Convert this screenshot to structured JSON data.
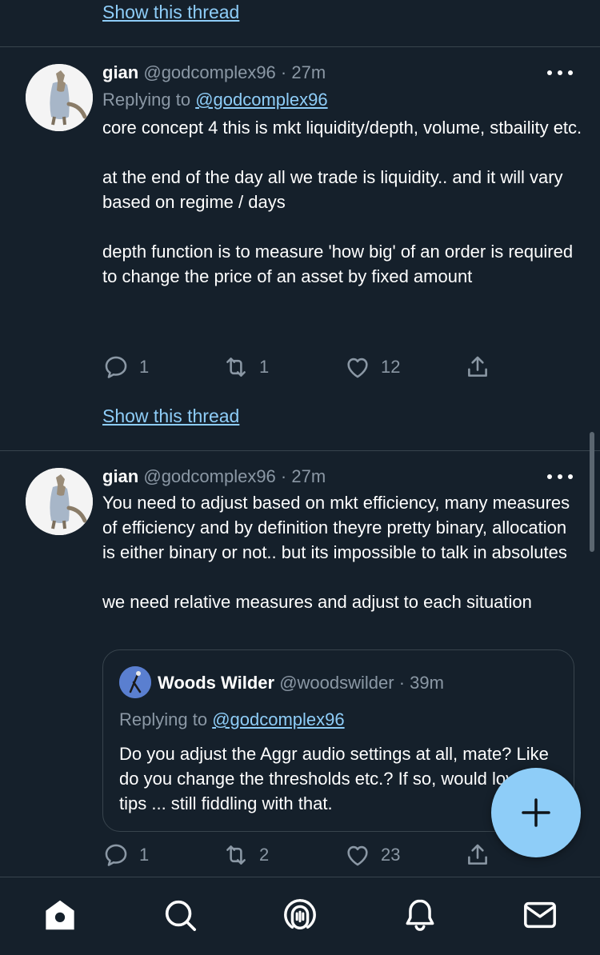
{
  "top": {
    "show_thread": "Show this thread"
  },
  "tweets": [
    {
      "name": "gian",
      "handle": "@godcomplex96",
      "sep": " · ",
      "time": "27m",
      "replying_prefix": "Replying to ",
      "replying_to": "@godcomplex96",
      "paragraphs": [
        "core concept 4 this is mkt liquidity/depth, volume, stbaility etc.",
        "at the end of the day all we trade is liquidity.. and it will vary based on regime / days",
        "depth function is to measure 'how big' of an order is required to change the price of an asset by fixed amount"
      ],
      "replies": "1",
      "retweets": "1",
      "likes": "12",
      "show_thread": "Show this thread"
    },
    {
      "name": "gian",
      "handle": "@godcomplex96",
      "sep": " · ",
      "time": "27m",
      "paragraphs": [
        "You need to adjust based on mkt efficiency, many measures of efficiency and by definition theyre pretty binary, allocation is either binary or not.. but its impossible to talk in absolutes",
        "we need relative measures and adjust to each situation"
      ],
      "quote": {
        "name": "Woods Wilder",
        "handle": "@woodswilder",
        "sep": " · ",
        "time": "39m",
        "replying_prefix": "Replying to ",
        "replying_to": "@godcomplex96",
        "text": "Do you adjust the Aggr audio settings at all, mate? Like do you change the thresholds etc.? If so, would love any tips ... still fiddling with that."
      },
      "replies": "1",
      "retweets": "2",
      "likes": "23"
    }
  ],
  "nav": [
    "home-icon",
    "search-icon",
    "spaces-icon",
    "notifications-icon",
    "messages-icon"
  ],
  "icons": {
    "reply": "reply-icon",
    "retweet": "retweet-icon",
    "like": "like-icon",
    "share": "share-icon",
    "compose": "plus-icon"
  },
  "colors": {
    "background": "#15202b",
    "link": "#8ecdf8",
    "muted": "#8b98a5",
    "border": "#38444d",
    "fab": "#8ecdf8"
  }
}
